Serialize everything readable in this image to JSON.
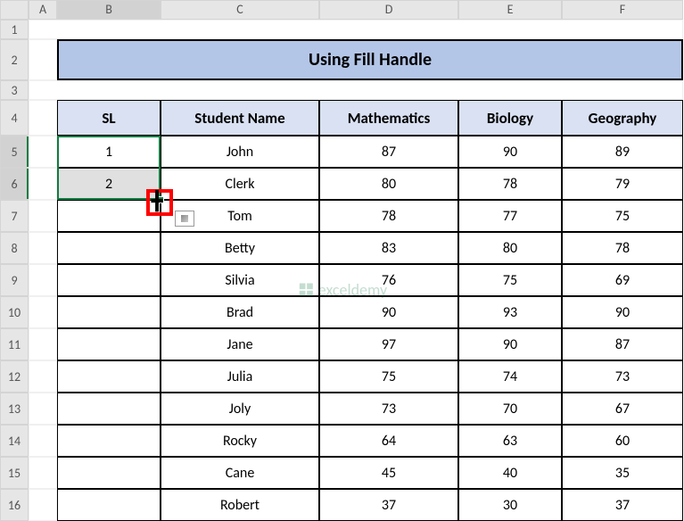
{
  "columns": [
    "A",
    "B",
    "C",
    "D",
    "E",
    "F"
  ],
  "rows": [
    "1",
    "2",
    "3",
    "4",
    "5",
    "6",
    "7",
    "8",
    "9",
    "10",
    "11",
    "12",
    "13",
    "14",
    "15",
    "16"
  ],
  "selected_rows": [
    "5",
    "6"
  ],
  "selected_column": "B",
  "title": "Using Fill Handle",
  "headers": {
    "sl": "SL",
    "name": "Student Name",
    "math": "Mathematics",
    "bio": "Biology",
    "geo": "Geography"
  },
  "data": [
    {
      "sl": "1",
      "name": "John",
      "math": "87",
      "bio": "90",
      "geo": "89"
    },
    {
      "sl": "2",
      "name": "Clerk",
      "math": "80",
      "bio": "78",
      "geo": "79"
    },
    {
      "sl": "",
      "name": "Tom",
      "math": "78",
      "bio": "77",
      "geo": "75"
    },
    {
      "sl": "",
      "name": "Betty",
      "math": "83",
      "bio": "80",
      "geo": "78"
    },
    {
      "sl": "",
      "name": "Silvia",
      "math": "76",
      "bio": "75",
      "geo": "69"
    },
    {
      "sl": "",
      "name": "Brad",
      "math": "90",
      "bio": "93",
      "geo": "90"
    },
    {
      "sl": "",
      "name": "Jane",
      "math": "97",
      "bio": "90",
      "geo": "87"
    },
    {
      "sl": "",
      "name": "Julia",
      "math": "75",
      "bio": "74",
      "geo": "73"
    },
    {
      "sl": "",
      "name": "Joly",
      "math": "73",
      "bio": "70",
      "geo": "67"
    },
    {
      "sl": "",
      "name": "Rocky",
      "math": "64",
      "bio": "63",
      "geo": "60"
    },
    {
      "sl": "",
      "name": "Cane",
      "math": "45",
      "bio": "40",
      "geo": "35"
    },
    {
      "sl": "",
      "name": "Robert",
      "math": "37",
      "bio": "30",
      "geo": "37"
    }
  ],
  "watermark": "exceldemy"
}
